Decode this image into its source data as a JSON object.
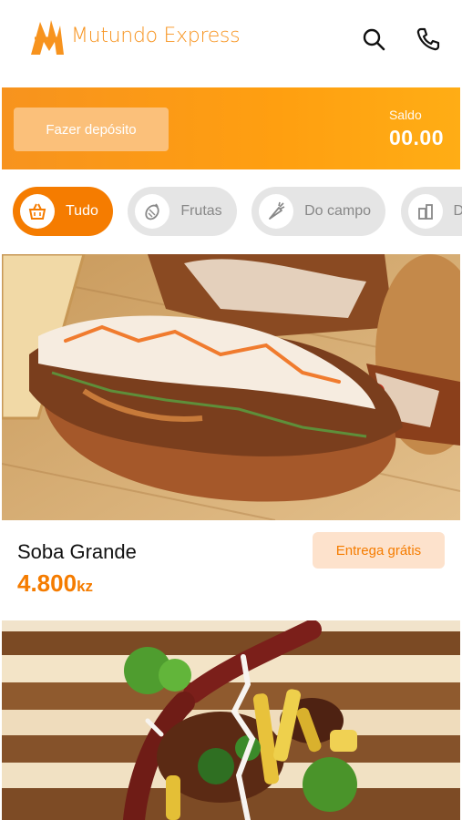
{
  "header": {
    "logo_text": "Mutundo Express",
    "search_icon": "search-icon",
    "phone_icon": "phone-icon"
  },
  "banner": {
    "deposit_label": "Fazer depósito",
    "balance_label": "Saldo",
    "balance_value": "00.00"
  },
  "categories": [
    {
      "label": "Tudo",
      "icon": "basket-icon",
      "active": true
    },
    {
      "label": "Frutas",
      "icon": "fruit-icon",
      "active": false
    },
    {
      "label": "Do campo",
      "icon": "carrot-icon",
      "active": false
    },
    {
      "label": "Do",
      "icon": "drink-icon",
      "active": false
    }
  ],
  "products": [
    {
      "name": "Soba Grande",
      "price": "4.800",
      "currency": "kz",
      "badge": "Entrega grátis"
    }
  ],
  "colors": {
    "accent": "#f57c00",
    "banner_start": "#f7931e",
    "banner_end": "#ffad15",
    "badge_bg": "#fde2cc"
  }
}
